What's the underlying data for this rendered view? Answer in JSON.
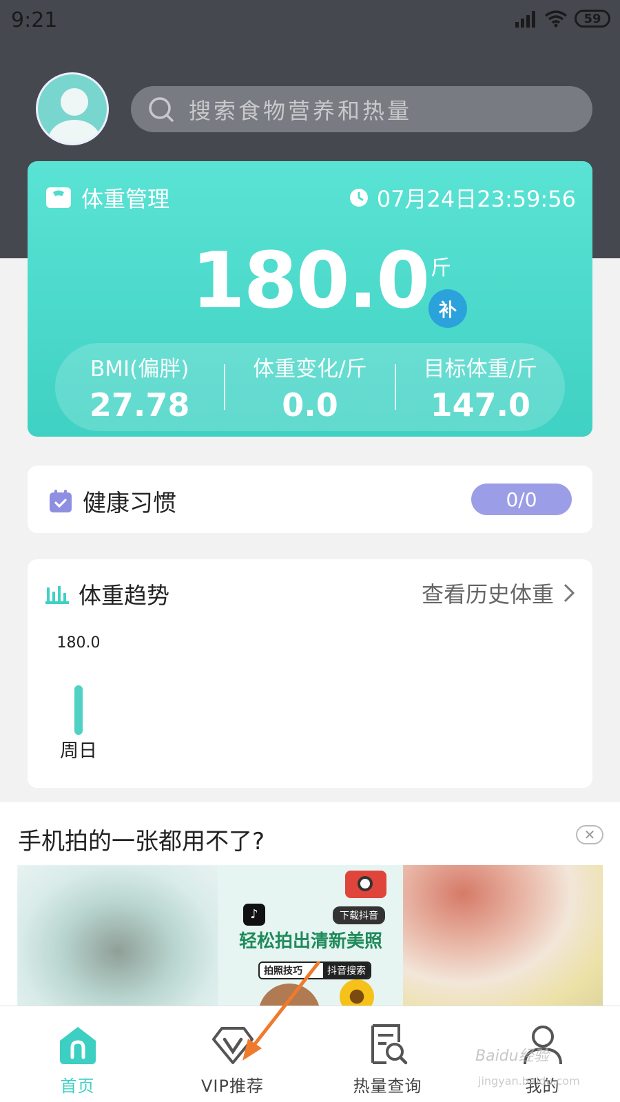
{
  "status_bar": {
    "time": "9:21",
    "battery": "59"
  },
  "search": {
    "placeholder": "搜索食物营养和热量"
  },
  "weight_card": {
    "title": "体重管理",
    "timestamp": "07月24日23:59:56",
    "weight": "180.0",
    "unit": "斤",
    "supplement_badge": "补",
    "stats": [
      {
        "label": "BMI(偏胖)",
        "value": "27.78"
      },
      {
        "label": "体重变化/斤",
        "value": "0.0"
      },
      {
        "label": "目标体重/斤",
        "value": "147.0"
      }
    ],
    "accent_color": "#4fdccd"
  },
  "habit_card": {
    "title": "健康习惯",
    "progress": "0/0"
  },
  "trend_card": {
    "title": "体重趋势",
    "link": "查看历史体重",
    "chart_data": {
      "type": "bar",
      "categories": [
        "周日"
      ],
      "values": [
        180.0
      ],
      "value_labels": [
        "180.0"
      ],
      "xlabel": "",
      "ylabel": "",
      "bar_color": "#4fd2c3"
    }
  },
  "ad": {
    "title": "手机拍的一张都用不了?",
    "mid_headline": "轻松拍出清新美照",
    "mid_download": "下载抖音",
    "mid_search_query": "拍照技巧",
    "mid_search_button": "抖音搜索"
  },
  "tabbar": {
    "items": [
      {
        "label": "首页",
        "icon": "home-icon",
        "active": true
      },
      {
        "label": "VIP推荐",
        "icon": "vip-icon",
        "active": false
      },
      {
        "label": "热量查询",
        "icon": "calorie-search-icon",
        "active": false
      },
      {
        "label": "我的",
        "icon": "profile-icon",
        "active": false
      }
    ],
    "active_color": "#3dcfc2"
  },
  "watermark": {
    "text": "Baidu经验",
    "sub": "jingyan.baidu.com"
  }
}
